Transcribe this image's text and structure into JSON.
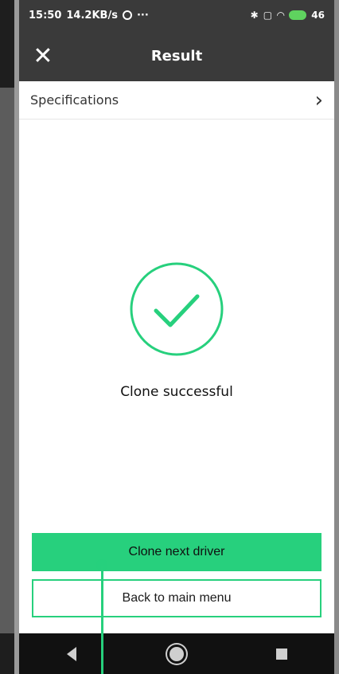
{
  "status_bar": {
    "time": "15:50",
    "speed": "14.2KB/s",
    "extra": "···",
    "battery": "46"
  },
  "app_bar": {
    "title": "Result",
    "close_icon": "close-icon"
  },
  "specifications": {
    "label": "Specifications",
    "chevron_icon": "chevron-right-icon"
  },
  "result": {
    "icon": "check-circle-icon",
    "message": "Clone successful"
  },
  "actions": {
    "primary_label": "Clone next driver",
    "secondary_label": "Back to main menu"
  },
  "nav": {
    "back_icon": "back-icon",
    "home_icon": "home-icon",
    "recents_icon": "recents-icon"
  },
  "colors": {
    "accent": "#27d07d",
    "app_bar": "#3a3a3a",
    "nav_bar": "#111111"
  }
}
